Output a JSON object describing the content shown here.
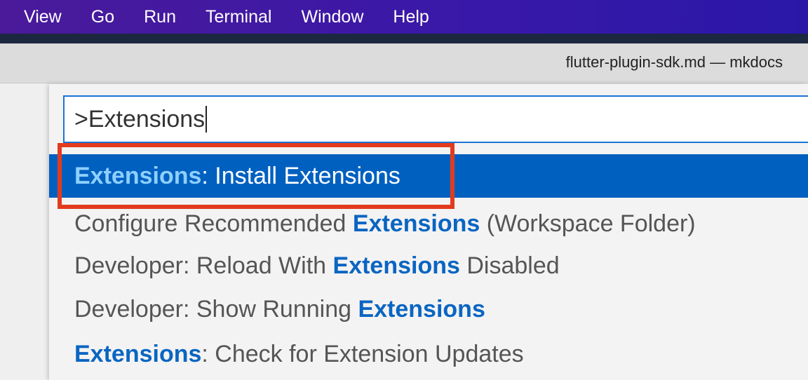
{
  "menubar": {
    "items": [
      "View",
      "Go",
      "Run",
      "Terminal",
      "Window",
      "Help"
    ]
  },
  "window": {
    "title": "flutter-plugin-sdk.md — mkdocs"
  },
  "command_palette": {
    "input_value": ">Extensions",
    "results": [
      {
        "prefix": "",
        "match": "Extensions",
        "suffix": ": Install Extensions",
        "selected": true
      },
      {
        "prefix": "Configure Recommended ",
        "match": "Extensions",
        "suffix": " (Workspace Folder)",
        "selected": false
      },
      {
        "prefix": "Developer: Reload With ",
        "match": "Extensions",
        "suffix": " Disabled",
        "selected": false
      },
      {
        "prefix": "Developer: Show Running ",
        "match": "Extensions",
        "suffix": "",
        "selected": false
      },
      {
        "prefix": "",
        "match": "Extensions",
        "suffix": ": Check for Extension Updates",
        "selected": false
      }
    ]
  },
  "colors": {
    "menubar": "#3a18a8",
    "selection": "#0060c0",
    "match_highlight": "#0a65c2",
    "annotation_box": "#e23b1e"
  }
}
